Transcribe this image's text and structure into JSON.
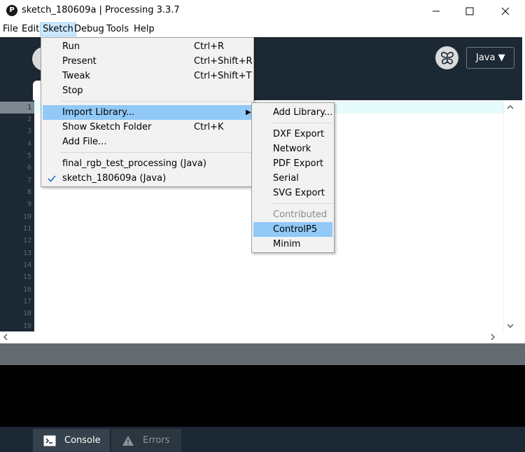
{
  "window": {
    "title": "sketch_180609a | Processing 3.3.7",
    "app_icon_glyph": "P"
  },
  "menubar": {
    "items": [
      "File",
      "Edit",
      "Sketch",
      "Debug",
      "Tools",
      "Help"
    ],
    "active": "Sketch"
  },
  "toolbar": {
    "mode_label": "Java ▼",
    "mode_icon": "butterfly-icon"
  },
  "editor": {
    "line_numbers": [
      "1",
      "2",
      "3",
      "4",
      "5",
      "6",
      "7",
      "8",
      "9",
      "10",
      "11",
      "12",
      "13",
      "14",
      "15",
      "16",
      "17",
      "18",
      "19"
    ],
    "current_line": "1"
  },
  "sketch_menu": {
    "items": [
      {
        "label": "Run",
        "shortcut": "Ctrl+R"
      },
      {
        "label": "Present",
        "shortcut": "Ctrl+Shift+R"
      },
      {
        "label": "Tweak",
        "shortcut": "Ctrl+Shift+T"
      },
      {
        "label": "Stop",
        "shortcut": ""
      },
      {
        "label": "Import Library...",
        "shortcut": ""
      },
      {
        "label": "Show Sketch Folder",
        "shortcut": "Ctrl+K"
      },
      {
        "label": "Add File...",
        "shortcut": ""
      },
      {
        "label": "final_rgb_test_processing (Java)",
        "shortcut": ""
      },
      {
        "label": "sketch_180609a (Java)",
        "shortcut": ""
      }
    ],
    "highlighted": "Import Library...",
    "checked": "sketch_180609a (Java)"
  },
  "import_library_submenu": {
    "items": [
      {
        "label": "Add Library...",
        "disabled": false
      },
      {
        "label": "DXF Export",
        "disabled": false
      },
      {
        "label": "Network",
        "disabled": false
      },
      {
        "label": "PDF Export",
        "disabled": false
      },
      {
        "label": "Serial",
        "disabled": false
      },
      {
        "label": "SVG Export",
        "disabled": false
      },
      {
        "label": "Contributed",
        "disabled": true
      },
      {
        "label": "ControlP5",
        "disabled": false
      },
      {
        "label": "Minim",
        "disabled": false
      }
    ],
    "highlighted": "ControlP5"
  },
  "bottom_tabs": {
    "console_label": "Console",
    "errors_label": "Errors"
  },
  "colors": {
    "editor_bg": "#1c2833",
    "highlight": "#91c9f7",
    "menu_active": "#cce8ff"
  }
}
